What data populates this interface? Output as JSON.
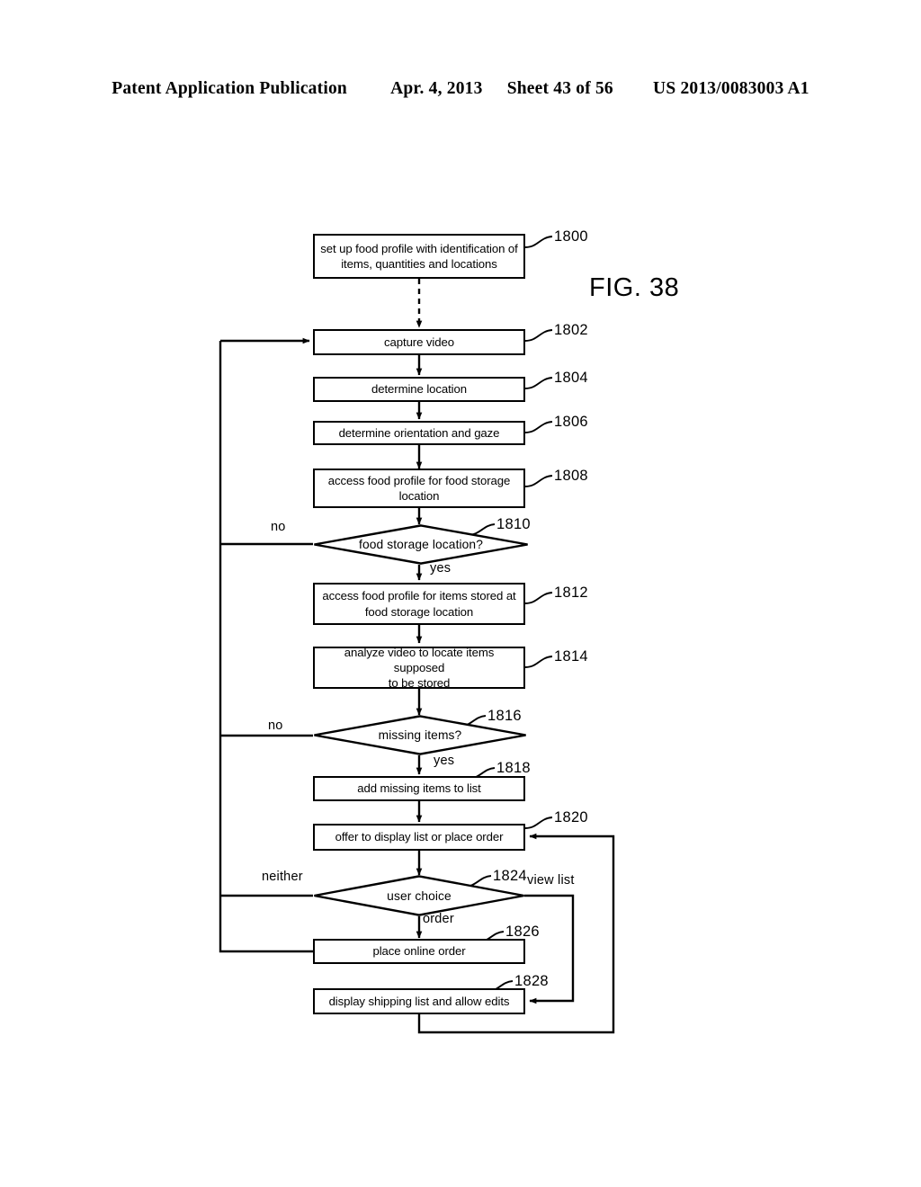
{
  "header": {
    "publication": "Patent Application Publication",
    "date": "Apr. 4, 2013",
    "sheet": "Sheet 43 of 56",
    "docnum": "US 2013/0083003 A1"
  },
  "figure": {
    "label": "FIG. 38"
  },
  "flowchart": {
    "type": "flowchart",
    "nodes": [
      {
        "ref": "1800",
        "shape": "process",
        "text": "set up food profile with identification of items, quantities and locations",
        "line1": "set up food profile with identification of",
        "line2": "items, quantities and locations"
      },
      {
        "ref": "1802",
        "shape": "process",
        "text": "capture video",
        "line1": "capture video",
        "line2": ""
      },
      {
        "ref": "1804",
        "shape": "process",
        "text": "determine location",
        "line1": "determine location",
        "line2": ""
      },
      {
        "ref": "1806",
        "shape": "process",
        "text": "determine orientation and gaze",
        "line1": "determine orientation and gaze",
        "line2": ""
      },
      {
        "ref": "1808",
        "shape": "process",
        "text": "access food profile for food storage location",
        "line1": "access food profile for food storage",
        "line2": "location"
      },
      {
        "ref": "1810",
        "shape": "decision",
        "text": "food storage location?",
        "line1": "food storage location?",
        "line2": ""
      },
      {
        "ref": "1812",
        "shape": "process",
        "text": "access food profile for items stored at food storage location",
        "line1": "access food profile for items stored at",
        "line2": "food storage location"
      },
      {
        "ref": "1814",
        "shape": "process",
        "text": "analyze video to locate items supposed to be stored",
        "line1": "analyze video to locate items supposed",
        "line2": "to be stored"
      },
      {
        "ref": "1816",
        "shape": "decision",
        "text": "missing items?",
        "line1": "missing items?",
        "line2": ""
      },
      {
        "ref": "1818",
        "shape": "process",
        "text": "add missing items to list",
        "line1": "add missing items to list",
        "line2": ""
      },
      {
        "ref": "1820",
        "shape": "process",
        "text": "offer to display list or place order",
        "line1": "offer to display list or place order",
        "line2": ""
      },
      {
        "ref": "1824",
        "shape": "decision",
        "text": "user choice",
        "line1": "user choice",
        "line2": ""
      },
      {
        "ref": "1826",
        "shape": "process",
        "text": "place online order",
        "line1": "place online order",
        "line2": ""
      },
      {
        "ref": "1828",
        "shape": "process",
        "text": "display shipping list and allow edits",
        "line1": "display shipping list and allow edits",
        "line2": ""
      }
    ],
    "edge_labels": {
      "no_1810": "no",
      "yes_1810": "yes",
      "no_1816": "no",
      "yes_1816": "yes",
      "neither_1824": "neither",
      "view_list_1824": "view list",
      "order_1824": "order"
    }
  }
}
